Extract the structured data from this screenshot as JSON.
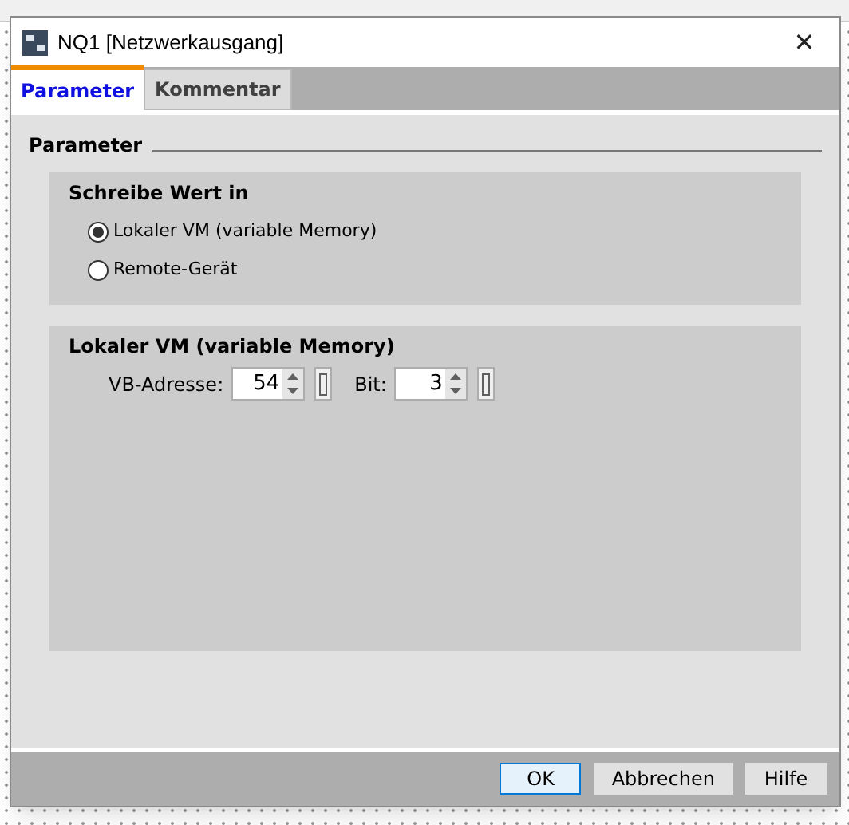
{
  "window": {
    "title": "NQ1 [Netzwerkausgang]",
    "close": "✕"
  },
  "tabs": [
    {
      "label": "Parameter",
      "selected": true
    },
    {
      "label": "Kommentar",
      "selected": false
    }
  ],
  "section_title": "Parameter",
  "write_group": {
    "title": "Schreibe Wert in",
    "options": [
      {
        "label": "Lokaler VM (variable Memory)",
        "selected": true
      },
      {
        "label": "Remote-Gerät",
        "selected": false
      }
    ]
  },
  "vm_group": {
    "title": "Lokaler VM (variable Memory)",
    "fields": [
      {
        "label": "VB-Adresse:",
        "value": "54"
      },
      {
        "label": "Bit:",
        "value": "3"
      }
    ]
  },
  "buttons": [
    {
      "label": "OK",
      "selected": true
    },
    {
      "label": "Abbrechen",
      "selected": false
    },
    {
      "label": "Hilfe",
      "selected": false
    }
  ]
}
